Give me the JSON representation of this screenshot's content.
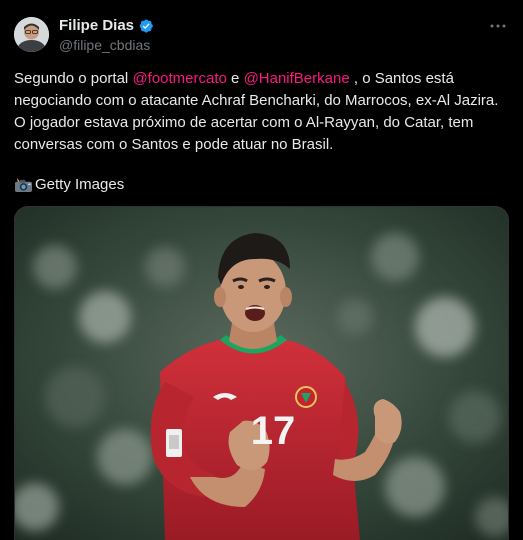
{
  "author": {
    "name": "Filipe Dias",
    "handle": "@filipe_cbdias"
  },
  "tweet": {
    "text_1": "Segundo o portal ",
    "mention_1": "@footmercato",
    "text_2": " e ",
    "mention_2": "@HanifBerkane",
    "text_3": " , o Santos está negociando com o atacante Achraf Bencharki, do Marrocos, ex-Al Jazira. O jogador estava próximo de acertar com o Al-Rayyan, do Catar, tem conversas com o Santos e pode atuar no Brasil.",
    "credit": "Getty Images"
  },
  "photo": {
    "jersey_number": "17"
  },
  "colors": {
    "mention": "#f91880",
    "verified": "#1d9bf0",
    "jersey": "#c4232f",
    "collar": "#1aa560"
  },
  "icons": [
    "verified-badge-icon",
    "more-options-icon",
    "camera-flash-icon"
  ]
}
